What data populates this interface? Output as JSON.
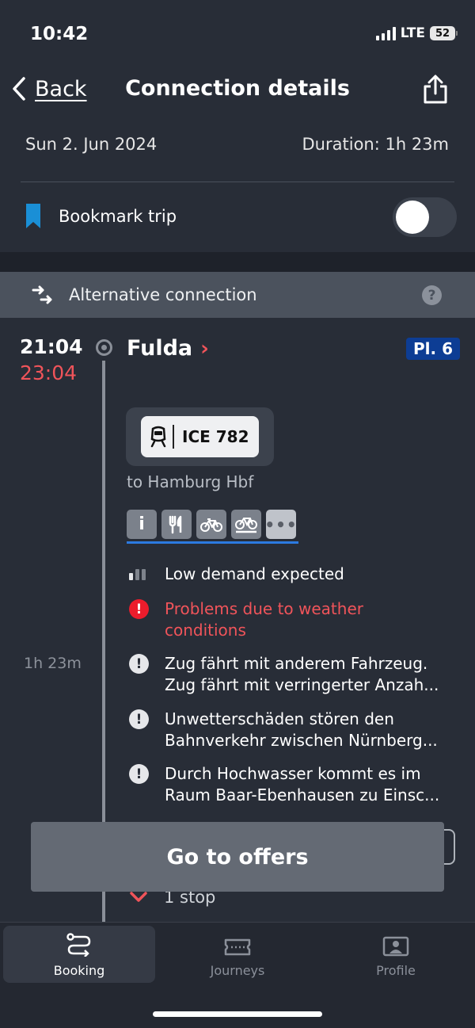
{
  "status_bar": {
    "time": "10:42",
    "network": "LTE",
    "battery": "52"
  },
  "header": {
    "back_label": "Back",
    "title": "Connection details",
    "share_icon": "share-icon"
  },
  "trip": {
    "date": "Sun 2. Jun 2024",
    "duration": "Duration: 1h 23m",
    "bookmark_label": "Bookmark trip",
    "bookmark_on": false
  },
  "alternative": {
    "label": "Alternative connection",
    "help": "?"
  },
  "leg": {
    "time_planned": "21:04",
    "time_actual": "23:04",
    "station": "Fulda",
    "platform": "Pl. 6",
    "train": "ICE 782",
    "destination": "to Hamburg Hbf",
    "amenities": [
      "info-icon",
      "restaurant-icon",
      "bike-icon",
      "bike-reservation-icon",
      "more-icon"
    ],
    "duration_side": "1h 23m",
    "messages": {
      "demand": "Low demand expected",
      "weather": "Problems due to weather conditions",
      "m1": "Zug fährt mit anderem Fahrzeug. Zug fährt mit verringerter Anzah...",
      "m2": "Unwetterschäden stören den Bahnverkehr zwischen Nürnberg...",
      "m3": "Durch Hochwasser kommt es im Raum Baar-Ebenhausen zu Einsc..."
    },
    "stops": "1 stop"
  },
  "offers_button": "Go to offers",
  "tabs": [
    {
      "label": "Booking",
      "icon": "route-icon",
      "active": true
    },
    {
      "label": "Journeys",
      "icon": "ticket-icon",
      "active": false
    },
    {
      "label": "Profile",
      "icon": "profile-icon",
      "active": false
    }
  ],
  "colors": {
    "background": "#282d37",
    "delay_red": "#f0545a",
    "platform_blue": "#0d3d94",
    "bookmark_blue": "#1a8fd6"
  }
}
